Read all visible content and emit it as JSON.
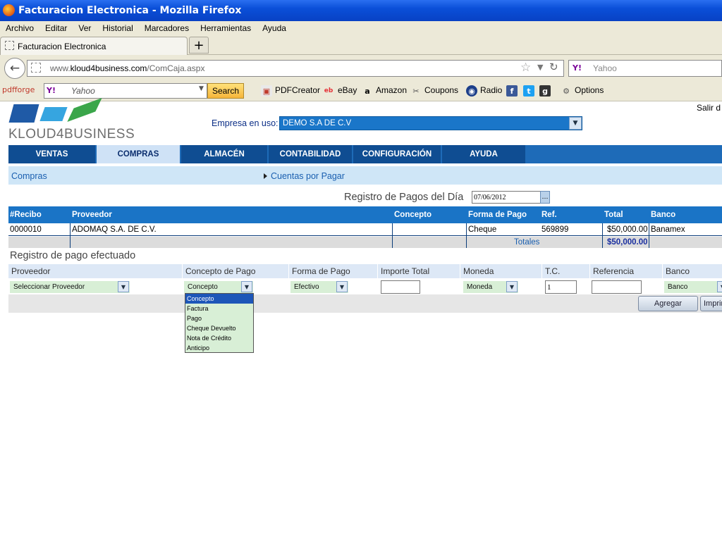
{
  "window": {
    "title": "Facturacion Electronica - Mozilla Firefox"
  },
  "menu": [
    "Archivo",
    "Editar",
    "Ver",
    "Historial",
    "Marcadores",
    "Herramientas",
    "Ayuda"
  ],
  "tab": {
    "label": "Facturacion Electronica",
    "new_tab": "+"
  },
  "address": {
    "prefix": "www.",
    "domain": "kloud4business.com",
    "path": "/ComCaja.aspx"
  },
  "browser_search": {
    "placeholder": "Yahoo",
    "engine": "Y!"
  },
  "toolbar2": {
    "pdfforge": "pdfforge",
    "yahoo_placeholder": "Yahoo",
    "yahoo_logo": "Y!",
    "search_btn": "Search",
    "pdfcreator": "PDFCreator",
    "ebay": "eBay",
    "amazon": "Amazon",
    "coupons": "Coupons",
    "radio": "Radio",
    "options": "Options"
  },
  "page": {
    "logo_text": "KLOUD4BUSINESS",
    "salir": "Salir d",
    "empresa_label": "Empresa en uso:",
    "empresa_value": "DEMO S.A DE C.V",
    "nav": [
      "VENTAS",
      "COMPRAS",
      "ALMACÉN",
      "CONTABILIDAD",
      "CONFIGURACIÓN",
      "AYUDA"
    ],
    "active_nav": "COMPRAS",
    "breadcrumb": {
      "section": "Compras",
      "page": "Cuentas por Pagar"
    },
    "registro_title": "Registro de Pagos del Día",
    "date": "07/06/2012",
    "table": {
      "headers": [
        "#Recibo",
        "Proveedor",
        "Concepto",
        "Forma de Pago",
        "Ref.",
        "Total",
        "Banco"
      ],
      "rows": [
        {
          "recibo": "0000010",
          "proveedor": "ADOMAQ S.A. DE C.V.",
          "concepto": "",
          "forma": "Cheque",
          "ref": "569899",
          "total": "$50,000.00",
          "banco": "Banamex"
        }
      ],
      "totales_label": "Totales",
      "totales_value": "$50,000.00"
    },
    "pago_title": "Registro de pago efectuado",
    "form": {
      "headers": [
        "Proveedor",
        "Concepto de Pago",
        "Forma de Pago",
        "Importe Total",
        "Moneda",
        "T.C.",
        "Referencia",
        "Banco"
      ],
      "proveedor": "Seleccionar Proveedor",
      "concepto": "Concepto",
      "forma": "Efectivo",
      "importe": "",
      "moneda": "Moneda",
      "tc": "1",
      "referencia": "",
      "banco": "Banco",
      "agregar": "Agregar",
      "imprimir": "Imprimir"
    },
    "concepto_options": [
      "Concepto",
      "Factura",
      "Pago",
      "Cheque Devuelto",
      "Nota de Crédito",
      "Anticipo"
    ]
  },
  "colors": {
    "nav_bg": "#0f4d92",
    "nav_active": "#cfe2f6",
    "header_blue": "#1a74c6",
    "green_select": "#d8efd6"
  }
}
